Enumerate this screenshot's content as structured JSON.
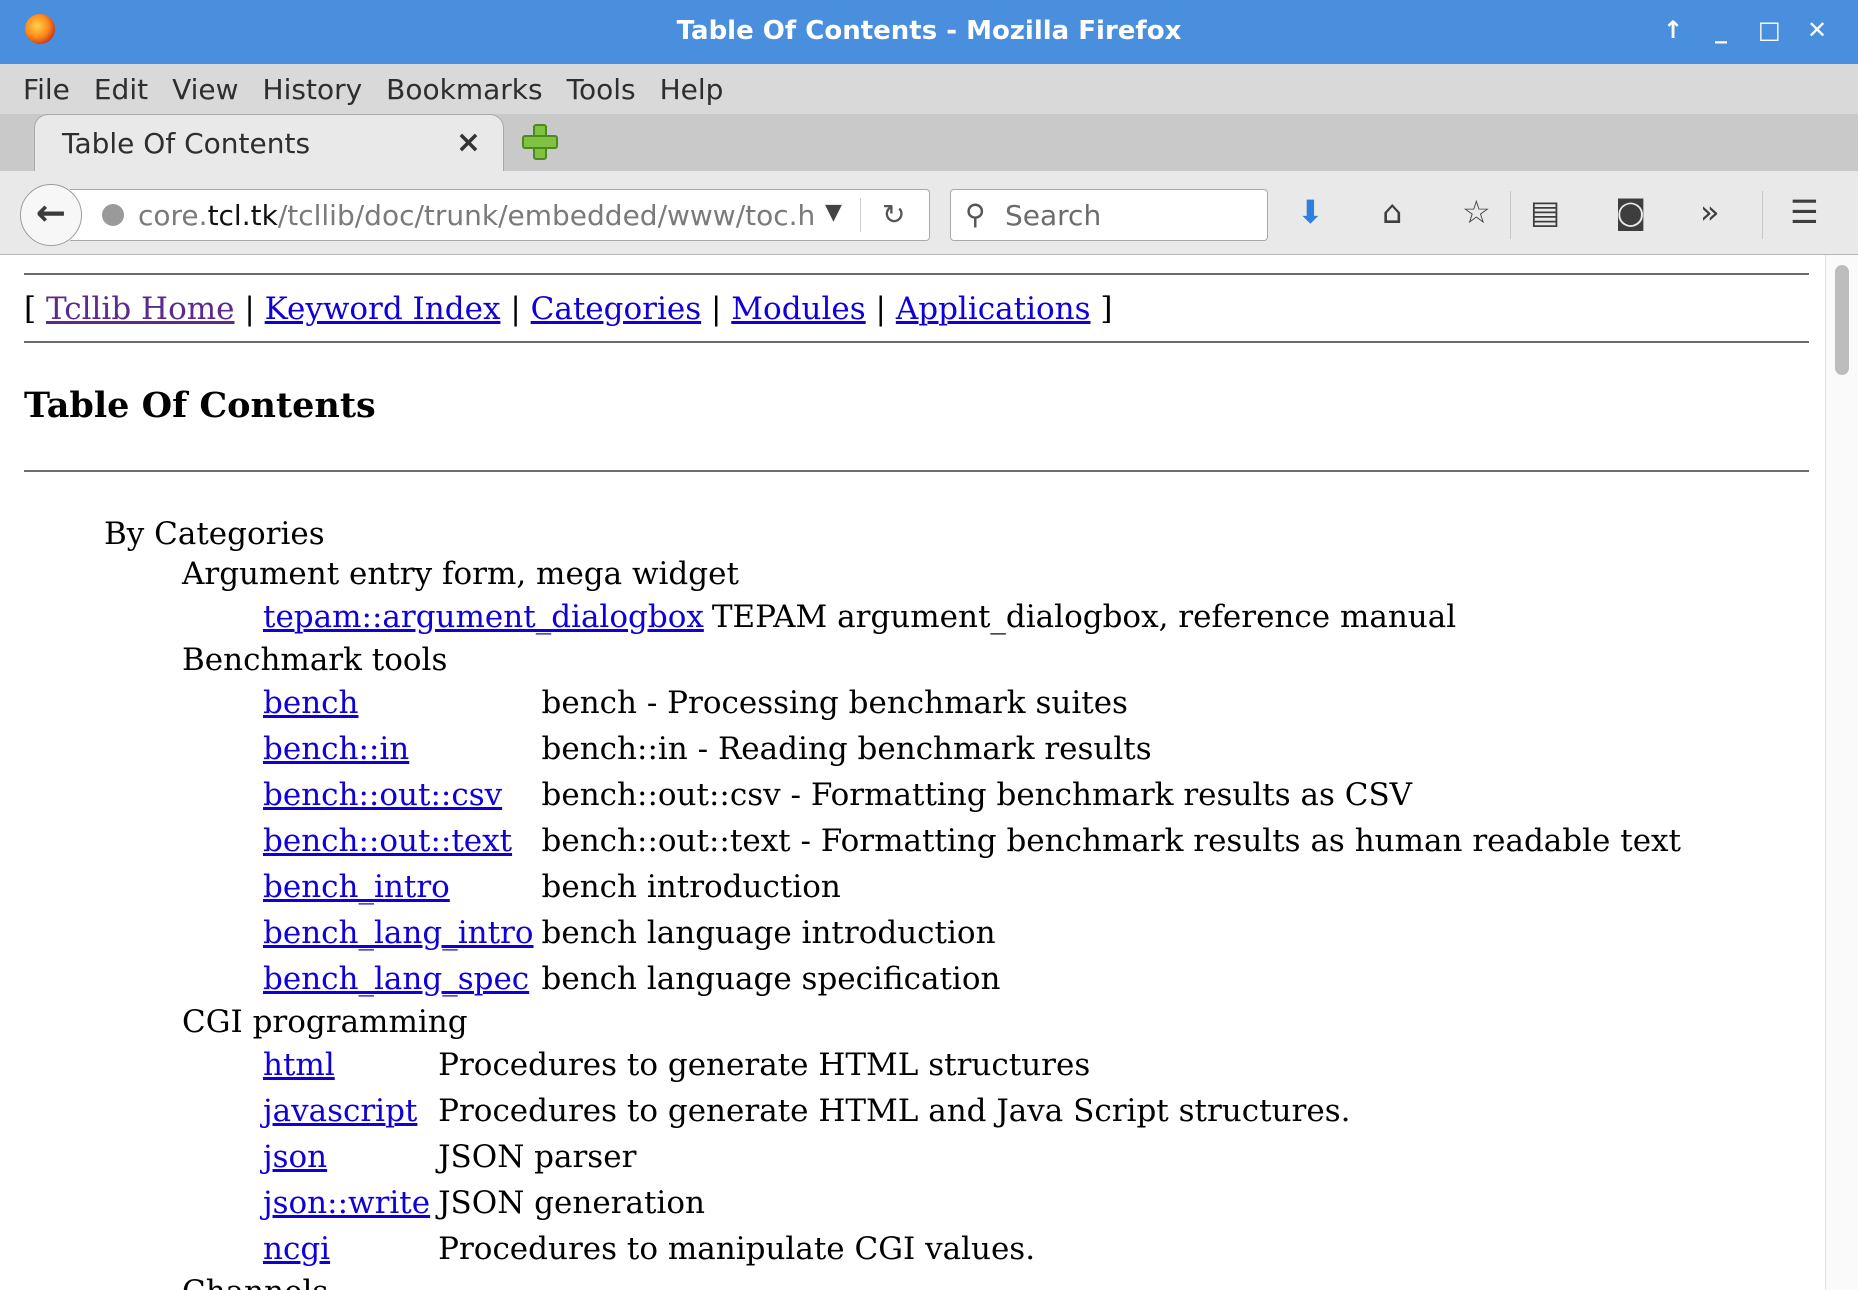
{
  "window": {
    "title": "Table Of Contents - Mozilla Firefox",
    "controls": [
      "↑",
      "_",
      "□",
      "✕"
    ]
  },
  "menubar": [
    "File",
    "Edit",
    "View",
    "History",
    "Bookmarks",
    "Tools",
    "Help"
  ],
  "tab": {
    "label": "Table Of Contents",
    "close": "×"
  },
  "navbar": {
    "url_prefix": "core.",
    "url_host": "tcl.tk",
    "url_path": "/tcllib/doc/trunk/embedded/www/toc.h",
    "search_placeholder": "Search",
    "icons": [
      "back-icon",
      "globe-icon",
      "reload-icon",
      "search-icon",
      "download-icon",
      "home-icon",
      "bookmark-star-icon",
      "reading-list-icon",
      "pocket-icon",
      "overflow-icon",
      "menu-icon"
    ]
  },
  "page": {
    "nav_open": "[",
    "nav_close": "]",
    "nav_sep": "|",
    "nav_links": [
      "Tcllib Home",
      "Keyword Index",
      "Categories",
      "Modules",
      "Applications"
    ],
    "title": "Table Of Contents",
    "by_categories": "By Categories",
    "categories": [
      {
        "name": "Argument entry form, mega widget",
        "entries": [
          {
            "key": "tepam::argument_dialogbox",
            "desc": "TEPAM argument_dialogbox, reference manual"
          }
        ]
      },
      {
        "name": "Benchmark tools",
        "entries": [
          {
            "key": "bench",
            "desc": "bench - Processing benchmark suites"
          },
          {
            "key": "bench::in",
            "desc": "bench::in - Reading benchmark results"
          },
          {
            "key": "bench::out::csv",
            "desc": "bench::out::csv - Formatting benchmark results as CSV"
          },
          {
            "key": "bench::out::text",
            "desc": "bench::out::text - Formatting benchmark results as human readable text"
          },
          {
            "key": "bench_intro",
            "desc": "bench introduction"
          },
          {
            "key": "bench_lang_intro",
            "desc": "bench language introduction"
          },
          {
            "key": "bench_lang_spec",
            "desc": "bench language specification"
          }
        ]
      },
      {
        "name": "CGI programming",
        "entries": [
          {
            "key": "html",
            "desc": "Procedures to generate HTML structures"
          },
          {
            "key": "javascript",
            "desc": "Procedures to generate HTML and Java Script structures."
          },
          {
            "key": "json",
            "desc": "JSON parser"
          },
          {
            "key": "json::write",
            "desc": "JSON generation"
          },
          {
            "key": "ncgi",
            "desc": "Procedures to manipulate CGI values."
          }
        ]
      },
      {
        "name": "Channels",
        "entries": []
      }
    ]
  }
}
